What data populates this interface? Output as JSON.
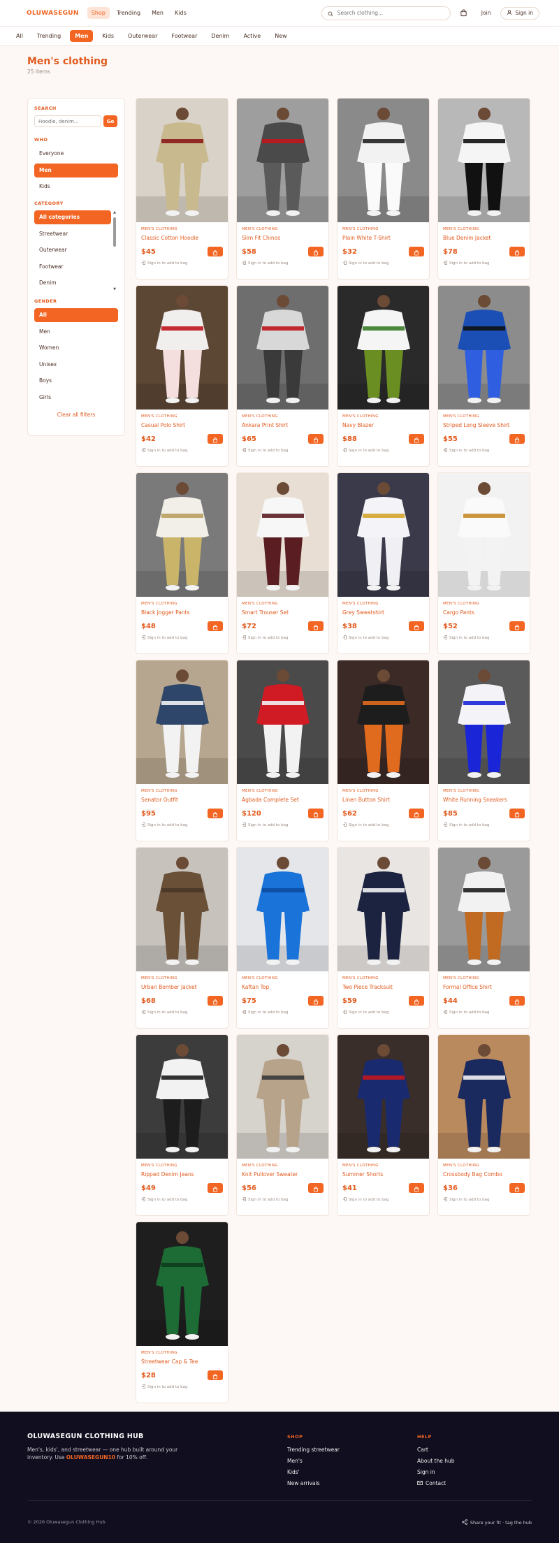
{
  "header": {
    "logo": "OLUWASEGUN",
    "nav": [
      {
        "label": "Shop",
        "active": true
      },
      {
        "label": "Trending",
        "active": false
      },
      {
        "label": "Men",
        "active": false
      },
      {
        "label": "Kids",
        "active": false
      }
    ],
    "search_placeholder": "Search clothing...",
    "bag_icon": "shopping-bag-icon",
    "join_label": "Join",
    "signin_label": "Sign in"
  },
  "categories_bar": [
    {
      "label": "All",
      "active": false
    },
    {
      "label": "Trending",
      "active": false
    },
    {
      "label": "Men",
      "active": true
    },
    {
      "label": "Kids",
      "active": false
    },
    {
      "label": "Outerwear",
      "active": false
    },
    {
      "label": "Footwear",
      "active": false
    },
    {
      "label": "Denim",
      "active": false
    },
    {
      "label": "Active",
      "active": false
    },
    {
      "label": "New",
      "active": false
    }
  ],
  "page": {
    "title": "Men's clothing",
    "count": "25 items"
  },
  "sidebar": {
    "search_label": "SEARCH",
    "search_placeholder": "Hoodie, denim...",
    "go_label": "Go",
    "who_label": "WHO",
    "who": [
      {
        "label": "Everyone",
        "active": false
      },
      {
        "label": "Men",
        "active": true
      },
      {
        "label": "Kids",
        "active": false
      }
    ],
    "category_label": "CATEGORY",
    "category": [
      {
        "label": "All categories",
        "active": true
      },
      {
        "label": "Streetwear",
        "active": false
      },
      {
        "label": "Outerwear",
        "active": false
      },
      {
        "label": "Footwear",
        "active": false
      },
      {
        "label": "Denim",
        "active": false
      }
    ],
    "gender_label": "GENDER",
    "gender": [
      {
        "label": "All",
        "active": true
      },
      {
        "label": "Men",
        "active": false
      },
      {
        "label": "Women",
        "active": false
      },
      {
        "label": "Unisex",
        "active": false
      },
      {
        "label": "Boys",
        "active": false
      },
      {
        "label": "Girls",
        "active": false
      }
    ],
    "clear_label": "Clear all filters"
  },
  "product_category_label": "MEN'S CLOTHING",
  "product_note": "Sign in to add to bag",
  "products": [
    {
      "title": "Classic Cotton Hoodie",
      "price": "$45",
      "bg": "#d9d2c8",
      "top": "#c8b98e",
      "bottom": "#c8b98e",
      "accent": "#8b1a1a"
    },
    {
      "title": "Slim Fit Chinos",
      "price": "$58",
      "bg": "#9e9e9e",
      "top": "#4a4a4a",
      "bottom": "#5a5a5a",
      "accent": "#c0161c"
    },
    {
      "title": "Plain White T-Shirt",
      "price": "$32",
      "bg": "#8a8a8a",
      "top": "#f2f2f2",
      "bottom": "#fafafa",
      "accent": "#222222"
    },
    {
      "title": "Blue Denim Jacket",
      "price": "$78",
      "bg": "#b8b8b8",
      "top": "#f5f5f5",
      "bottom": "#111111",
      "accent": "#111111"
    },
    {
      "title": "Casual Polo Shirt",
      "price": "$42",
      "bg": "#5c4634",
      "top": "#f1eeee",
      "bottom": "#f4dede",
      "accent": "#c0161c"
    },
    {
      "title": "Ankara Print Shirt",
      "price": "$65",
      "bg": "#6e6e6e",
      "top": "#d8d8d8",
      "bottom": "#3a3a3a",
      "accent": "#c0161c"
    },
    {
      "title": "Navy Blazer",
      "price": "$88",
      "bg": "#2a2a2a",
      "top": "#f5f5f5",
      "bottom": "#6b8e23",
      "accent": "#3a7d2a"
    },
    {
      "title": "Striped Long Sleeve Shirt",
      "price": "$55",
      "bg": "#8c8c8c",
      "top": "#1b4fb5",
      "bottom": "#2f5fe0",
      "accent": "#111111"
    },
    {
      "title": "Black Jogger Pants",
      "price": "$48",
      "bg": "#7a7a7a",
      "top": "#f1efe8",
      "bottom": "#c9b46a",
      "accent": "#b8a060"
    },
    {
      "title": "Smart Trouser Set",
      "price": "$72",
      "bg": "#e8ded4",
      "top": "#f7f7f7",
      "bottom": "#5a1e22",
      "accent": "#5a1e22"
    },
    {
      "title": "Grey Sweatshirt",
      "price": "$38",
      "bg": "#3a3a4a",
      "top": "#f4f4f8",
      "bottom": "#f0f0f4",
      "accent": "#d4a52a"
    },
    {
      "title": "Cargo Pants",
      "price": "$52",
      "bg": "#f2f2f2",
      "top": "#fafafa",
      "bottom": "#f3f3f3",
      "accent": "#c58b2a"
    },
    {
      "title": "Senator Outfit",
      "price": "$95",
      "bg": "#b7a68f",
      "top": "#2e4669",
      "bottom": "#f2f2f2",
      "accent": "#f2f2f2"
    },
    {
      "title": "Agbada Complete Set",
      "price": "$120",
      "bg": "#4a4a4a",
      "top": "#d01a24",
      "bottom": "#f2f2f2",
      "accent": "#f2f2f2"
    },
    {
      "title": "Linen Button Shirt",
      "price": "$62",
      "bg": "#3b2a26",
      "top": "#1d1d1d",
      "bottom": "#e06a1e",
      "accent": "#e06a1e"
    },
    {
      "title": "White Running Sneakers",
      "price": "$85",
      "bg": "#5a5a5a",
      "top": "#f4f4f8",
      "bottom": "#1a25d8",
      "accent": "#1a25d8"
    },
    {
      "title": "Urban Bomber Jacket",
      "price": "$68",
      "bg": "#c7c2bc",
      "top": "#6b5038",
      "bottom": "#6b5038",
      "accent": "#4a3626"
    },
    {
      "title": "Kaftan Top",
      "price": "$75",
      "bg": "#e4e6ea",
      "top": "#1a73d9",
      "bottom": "#1a73d9",
      "accent": "#0c4da0"
    },
    {
      "title": "Two Piece Tracksuit",
      "price": "$59",
      "bg": "#e9e5e2",
      "top": "#1c2340",
      "bottom": "#1c2340",
      "accent": "#f2f2f2"
    },
    {
      "title": "Formal Office Shirt",
      "price": "$44",
      "bg": "#9a9a9a",
      "top": "#f2f2f2",
      "bottom": "#c06a22",
      "accent": "#1d1d1d"
    },
    {
      "title": "Ripped Denim Jeans",
      "price": "$49",
      "bg": "#3c3c3c",
      "top": "#f2f2f2",
      "bottom": "#1d1d1d",
      "accent": "#1d1d1d"
    },
    {
      "title": "Knit Pullover Sweater",
      "price": "$56",
      "bg": "#d6d2cc",
      "top": "#b7a38a",
      "bottom": "#b7a38a",
      "accent": "#3a3a3a"
    },
    {
      "title": "Summer Shorts",
      "price": "$41",
      "bg": "#3a2e2a",
      "top": "#1a2a6e",
      "bottom": "#1a2a6e",
      "accent": "#c0161c"
    },
    {
      "title": "Crossbody Bag Combo",
      "price": "$36",
      "bg": "#b98a5e",
      "top": "#1a2a5e",
      "bottom": "#1a2a5e",
      "accent": "#f2f2f2"
    },
    {
      "title": "Streetwear Cap & Tee",
      "price": "$28",
      "bg": "#1e1e1e",
      "top": "#1d6b35",
      "bottom": "#1d6b35",
      "accent": "#0e3d1c"
    }
  ],
  "footer": {
    "brand": "OLUWASEGUN CLOTHING HUB",
    "tagline_before": "Men's, kids', and streetwear — one hub built around your inventory. Use ",
    "promo_code": "OLUWASEGUN10",
    "tagline_after": " for 10% off.",
    "shop_heading": "SHOP",
    "shop_links": [
      "Trending streetwear",
      "Men's",
      "Kids'",
      "New arrivals"
    ],
    "help_heading": "HELP",
    "help_links": [
      "Cart",
      "About the hub",
      "Sign in",
      "Contact"
    ],
    "copyright": "© 2026 Oluwasegun Clothing Hub",
    "share": "Share your fit · tag the hub"
  },
  "colors": {
    "accent": "#f26522",
    "footer_bg": "#100e1f"
  }
}
